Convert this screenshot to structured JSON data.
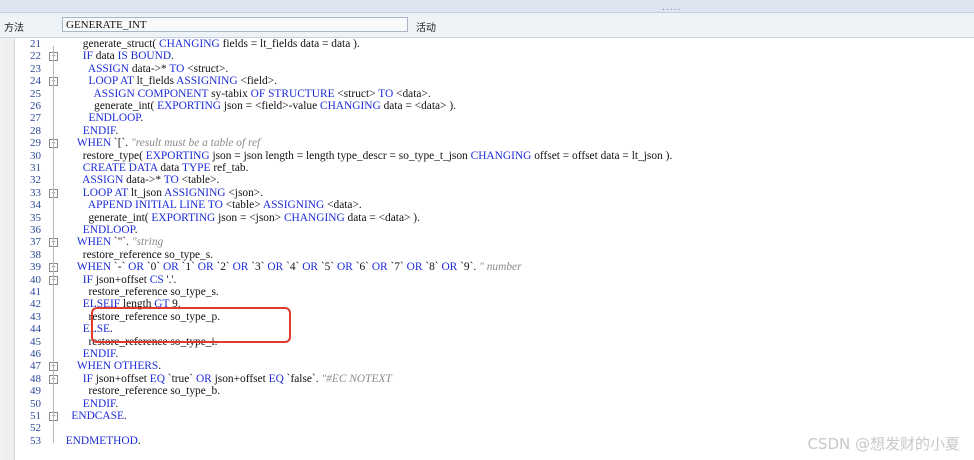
{
  "toolbar": {
    "grip": "....."
  },
  "method": {
    "label": "方法",
    "value": "GENERATE_INT",
    "status": "活动"
  },
  "editor": {
    "lines": [
      {
        "num": "21",
        "text": "        generate_struct( CHANGING fields = lt_fields data = data )."
      },
      {
        "num": "22",
        "text": "        IF data IS BOUND."
      },
      {
        "num": "23",
        "text": "          ASSIGN data->* TO <struct>."
      },
      {
        "num": "24",
        "text": "          LOOP AT lt_fields ASSIGNING <field>."
      },
      {
        "num": "25",
        "text": "            ASSIGN COMPONENT sy-tabix OF STRUCTURE <struct> TO <data>."
      },
      {
        "num": "26",
        "text": "            generate_int( EXPORTING json = <field>-value CHANGING data = <data> )."
      },
      {
        "num": "27",
        "text": "          ENDLOOP."
      },
      {
        "num": "28",
        "text": "        ENDIF."
      },
      {
        "num": "29",
        "text": "      WHEN `[`. \"result must be a table of ref"
      },
      {
        "num": "30",
        "text": "        restore_type( EXPORTING json = json length = length type_descr = so_type_t_json CHANGING offset = offset data = lt_json )."
      },
      {
        "num": "31",
        "text": "        CREATE DATA data TYPE ref_tab."
      },
      {
        "num": "32",
        "text": "        ASSIGN data->* TO <table>."
      },
      {
        "num": "33",
        "text": "        LOOP AT lt_json ASSIGNING <json>."
      },
      {
        "num": "34",
        "text": "          APPEND INITIAL LINE TO <table> ASSIGNING <data>."
      },
      {
        "num": "35",
        "text": "          generate_int( EXPORTING json = <json> CHANGING data = <data> )."
      },
      {
        "num": "36",
        "text": "        ENDLOOP."
      },
      {
        "num": "37",
        "text": "      WHEN `\"`. \"string"
      },
      {
        "num": "38",
        "text": "        restore_reference so_type_s."
      },
      {
        "num": "39",
        "text": "      WHEN `-` OR `0` OR `1` OR `2` OR `3` OR `4` OR `5` OR `6` OR `7` OR `8` OR `9`. \" number"
      },
      {
        "num": "40",
        "text": "        IF json+offset CS '.'."
      },
      {
        "num": "41",
        "text": "          restore_reference so_type_s."
      },
      {
        "num": "42",
        "text": "        ELSEIF length GT 9."
      },
      {
        "num": "43",
        "text": "          restore_reference so_type_p."
      },
      {
        "num": "44",
        "text": "        ELSE."
      },
      {
        "num": "45",
        "text": "          restore_reference so_type_i."
      },
      {
        "num": "46",
        "text": "        ENDIF."
      },
      {
        "num": "47",
        "text": "      WHEN OTHERS."
      },
      {
        "num": "48",
        "text": "        IF json+offset EQ `true` OR json+offset EQ `false`. \"#EC NOTEXT"
      },
      {
        "num": "49",
        "text": "          restore_reference so_type_b."
      },
      {
        "num": "50",
        "text": "        ENDIF."
      },
      {
        "num": "51",
        "text": "    ENDCASE."
      },
      {
        "num": "52",
        "text": ""
      },
      {
        "num": "53",
        "text": "  ENDMETHOD."
      }
    ]
  },
  "highlight": {
    "color": "#e23a2a"
  },
  "watermark": "CSDN @想发财的小夏"
}
